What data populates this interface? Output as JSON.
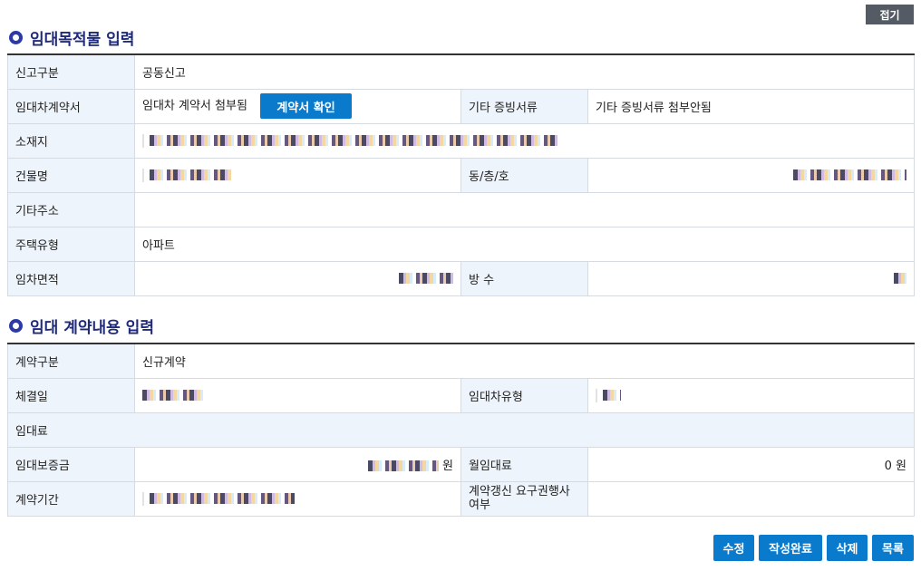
{
  "fold_button": "접기",
  "section1": {
    "title": "임대목적물 입력",
    "rows": {
      "report_type_label": "신고구분",
      "report_type_value": "공동신고",
      "contract_label": "임대차계약서",
      "contract_value": "임대차 계약서 첨부됨",
      "contract_button": "계약서 확인",
      "other_docs_label": "기타 증빙서류",
      "other_docs_value": "기타 증빙서류 첨부안됨",
      "location_label": "소재지",
      "building_label": "건물명",
      "dong_label": "동/층/호",
      "other_address_label": "기타주소",
      "housing_type_label": "주택유형",
      "housing_type_value": "아파트",
      "area_label": "임차면적",
      "rooms_label": "방 수"
    }
  },
  "section2": {
    "title": "임대 계약내용 입력",
    "rows": {
      "contract_type_label": "계약구분",
      "contract_type_value": "신규계약",
      "signed_date_label": "체결일",
      "lease_type_label": "임대차유형",
      "rent_label": "임대료",
      "deposit_label": "임대보증금",
      "deposit_unit": "원",
      "monthly_rent_label": "월임대료",
      "monthly_rent_value": "0 원",
      "period_label": "계약기간",
      "renewal_label_1": "계약갱신 요구권행사",
      "renewal_label_2": "여부"
    }
  },
  "actions": {
    "edit": "수정",
    "complete": "작성완료",
    "delete": "삭제",
    "list": "목록"
  }
}
